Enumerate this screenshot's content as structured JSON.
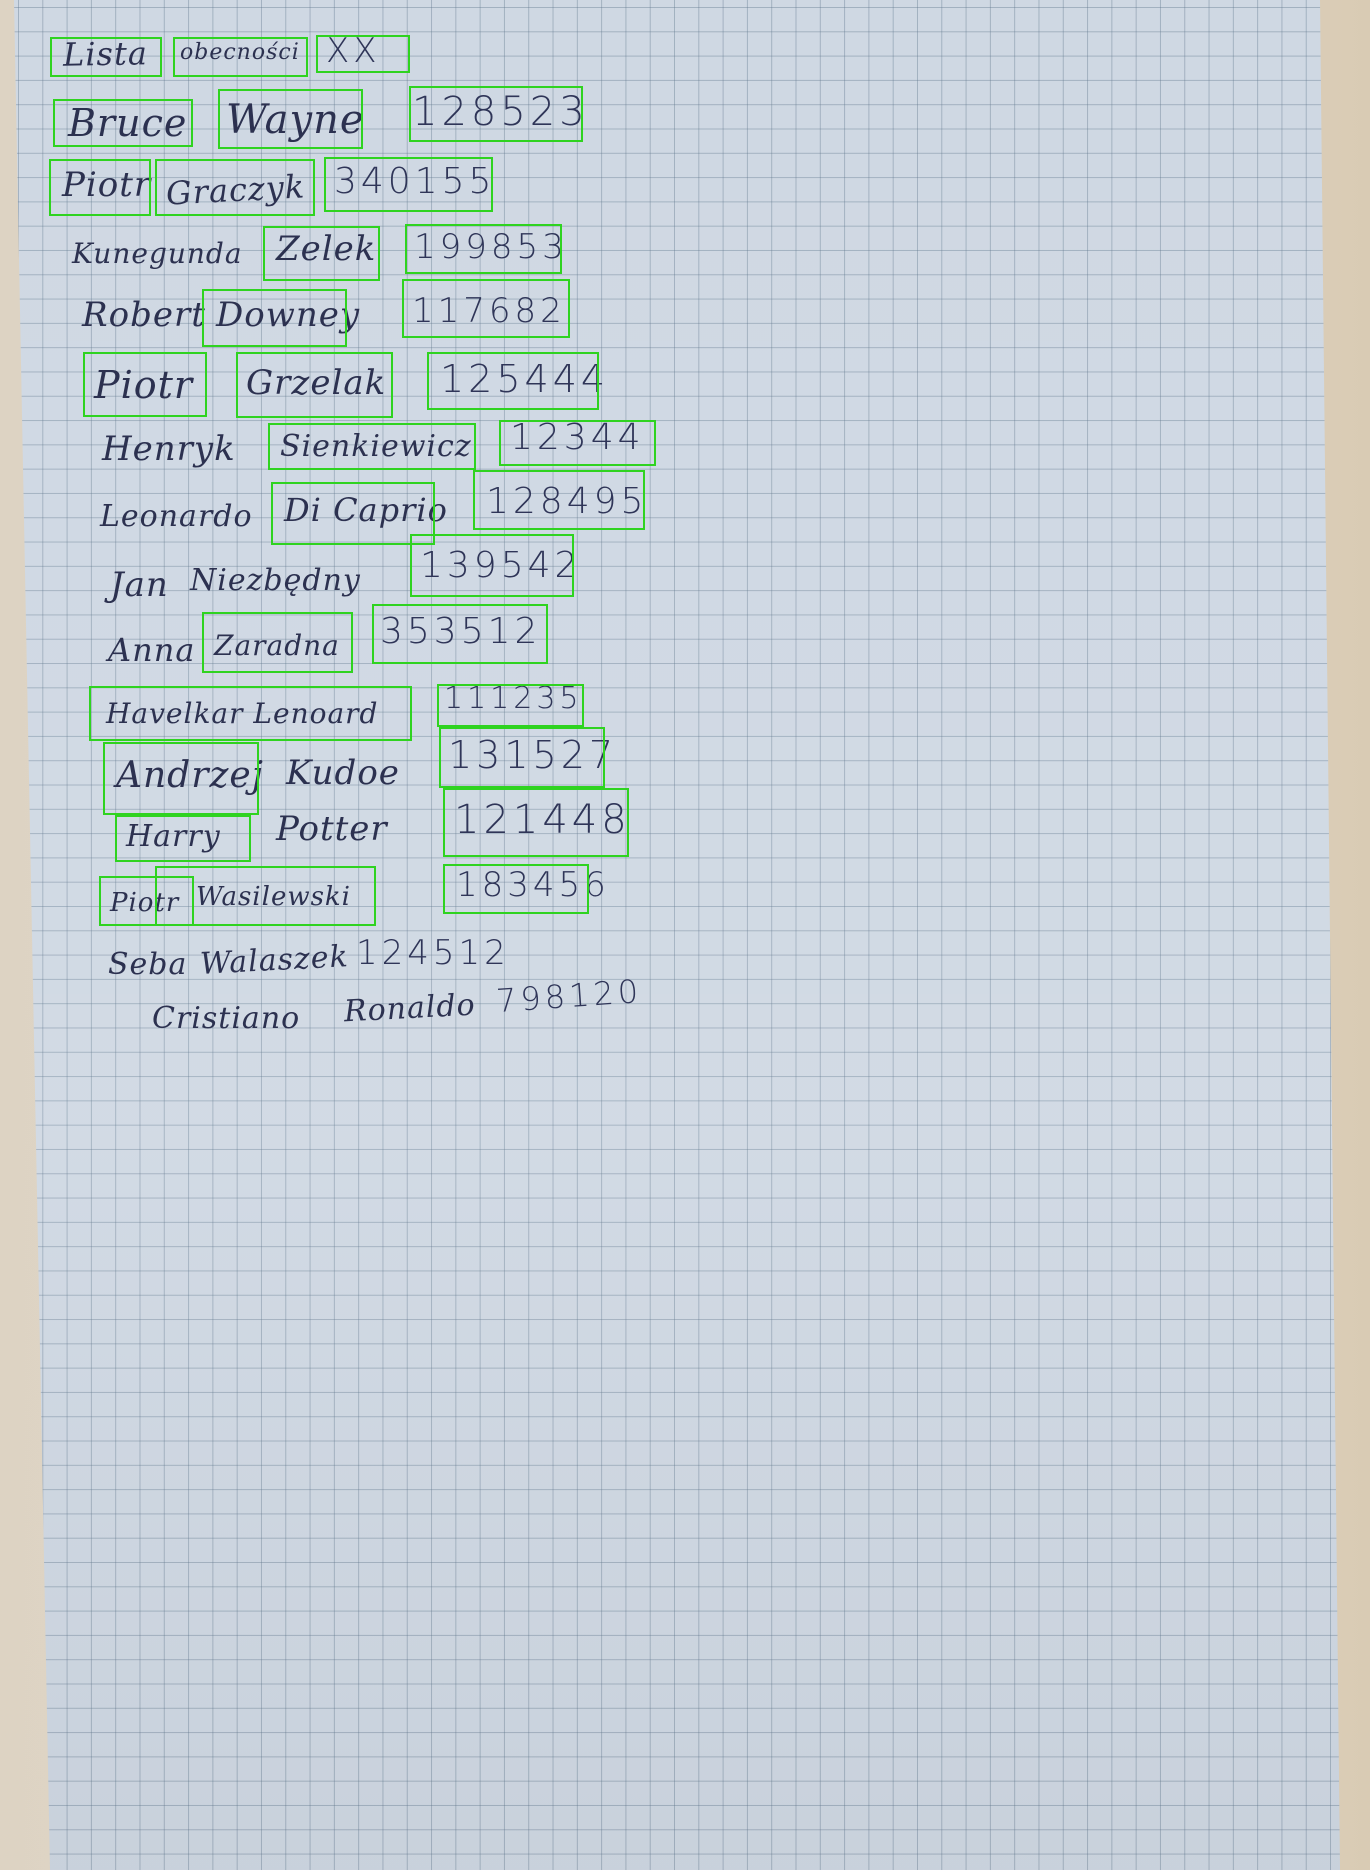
{
  "document": {
    "lines": [
      {
        "words": [
          "Lista",
          "obecności",
          "XX"
        ]
      },
      {
        "words": [
          "Bruce",
          "Wayne",
          "128523"
        ]
      },
      {
        "words": [
          "Piotr",
          "Graczyk",
          "340155"
        ]
      },
      {
        "words": [
          "Kunegunda",
          "Zelek",
          "199853"
        ]
      },
      {
        "words": [
          "Robert",
          "Downey",
          "117682"
        ]
      },
      {
        "words": [
          "Piotr",
          "Grzelak",
          "125444"
        ]
      },
      {
        "words": [
          "Henryk",
          "Sienkiewicz",
          "12344"
        ]
      },
      {
        "words": [
          "Leonardo",
          "Di Caprio",
          "128495"
        ]
      },
      {
        "words": [
          "Jan",
          "Niezbędny",
          "139542"
        ]
      },
      {
        "words": [
          "Anna",
          "Zaradna",
          "353512"
        ]
      },
      {
        "words": [
          "Havelkar Lenoard",
          "111235"
        ]
      },
      {
        "words": [
          "Andrzej",
          "Kudoe",
          "131527"
        ]
      },
      {
        "words": [
          "Harry",
          "Potter",
          "121448"
        ]
      },
      {
        "words": [
          "Piotr",
          "Wasilewski",
          "183456"
        ]
      },
      {
        "words": [
          "Seba",
          "Walaszek",
          "124512"
        ]
      },
      {
        "words": [
          "Cristiano",
          "Ronaldo",
          "798120"
        ]
      }
    ]
  },
  "colors": {
    "box": "#2fd320",
    "ink": "#2c3150",
    "paper": "#cfd8e3",
    "grid": "#5f768c",
    "desk": "#ddd3c3"
  }
}
